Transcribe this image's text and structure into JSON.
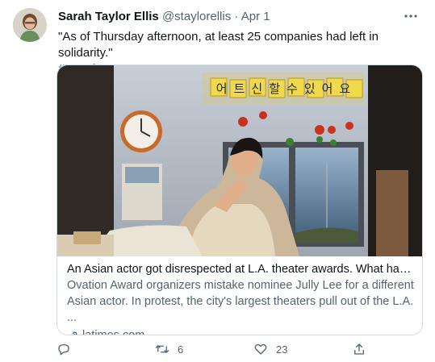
{
  "tweet": {
    "author_name": "Sarah Taylor Ellis",
    "handle": "@staylorellis",
    "separator": "·",
    "date": "Apr 1",
    "text": "\"As of Thursday afternoon, at least 25 companies had left in solidarity.\"",
    "hashtag": "#LeavingLASA"
  },
  "card": {
    "image_sign_text": "어트신할수있어요",
    "title": "An Asian actor got disrespected at L.A. theater awards. What happene...",
    "description": "Ovation Award organizers mistake nominee Jully Lee for a different Asian actor. In protest, the city's largest theaters pull out of the L.A. ...",
    "domain": "latimes.com"
  },
  "actions": {
    "reply_count": "",
    "retweet_count": "6",
    "like_count": "23"
  },
  "icons": {
    "more": "more-horizontal-icon",
    "reply": "reply-icon",
    "retweet": "retweet-icon",
    "like": "heart-icon",
    "share": "share-icon",
    "link": "link-icon"
  },
  "colors": {
    "accent": "#1d9bf0",
    "secondary_text": "#536471",
    "border": "#cfd9de"
  }
}
